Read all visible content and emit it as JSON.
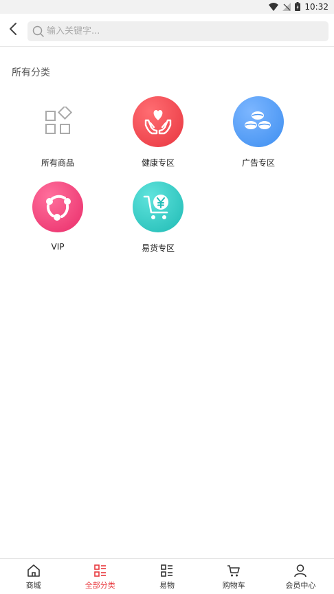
{
  "status_bar": {
    "time": "10:32"
  },
  "search": {
    "placeholder": "输入关键字..."
  },
  "section": {
    "title": "所有分类"
  },
  "categories": [
    {
      "label": "所有商品",
      "icon": "grid-shapes-icon"
    },
    {
      "label": "健康专区",
      "icon": "heart-hands-icon",
      "color": "#ef4b55"
    },
    {
      "label": "广告专区",
      "icon": "coffee-beans-icon",
      "color": "#4a9af0"
    },
    {
      "label": "VIP",
      "icon": "link-nodes-icon",
      "color": "#ee3d78"
    },
    {
      "label": "易货专区",
      "icon": "cart-yen-icon",
      "color": "#2ec9c4"
    }
  ],
  "bottom_nav": [
    {
      "label": "商城",
      "icon": "home-icon",
      "active": false
    },
    {
      "label": "全部分类",
      "icon": "category-list-icon",
      "active": true
    },
    {
      "label": "易物",
      "icon": "exchange-list-icon",
      "active": false
    },
    {
      "label": "购物车",
      "icon": "cart-icon",
      "active": false
    },
    {
      "label": "会员中心",
      "icon": "user-icon",
      "active": false
    }
  ],
  "colors": {
    "accent": "#e8383d",
    "nav_default": "#333333"
  }
}
